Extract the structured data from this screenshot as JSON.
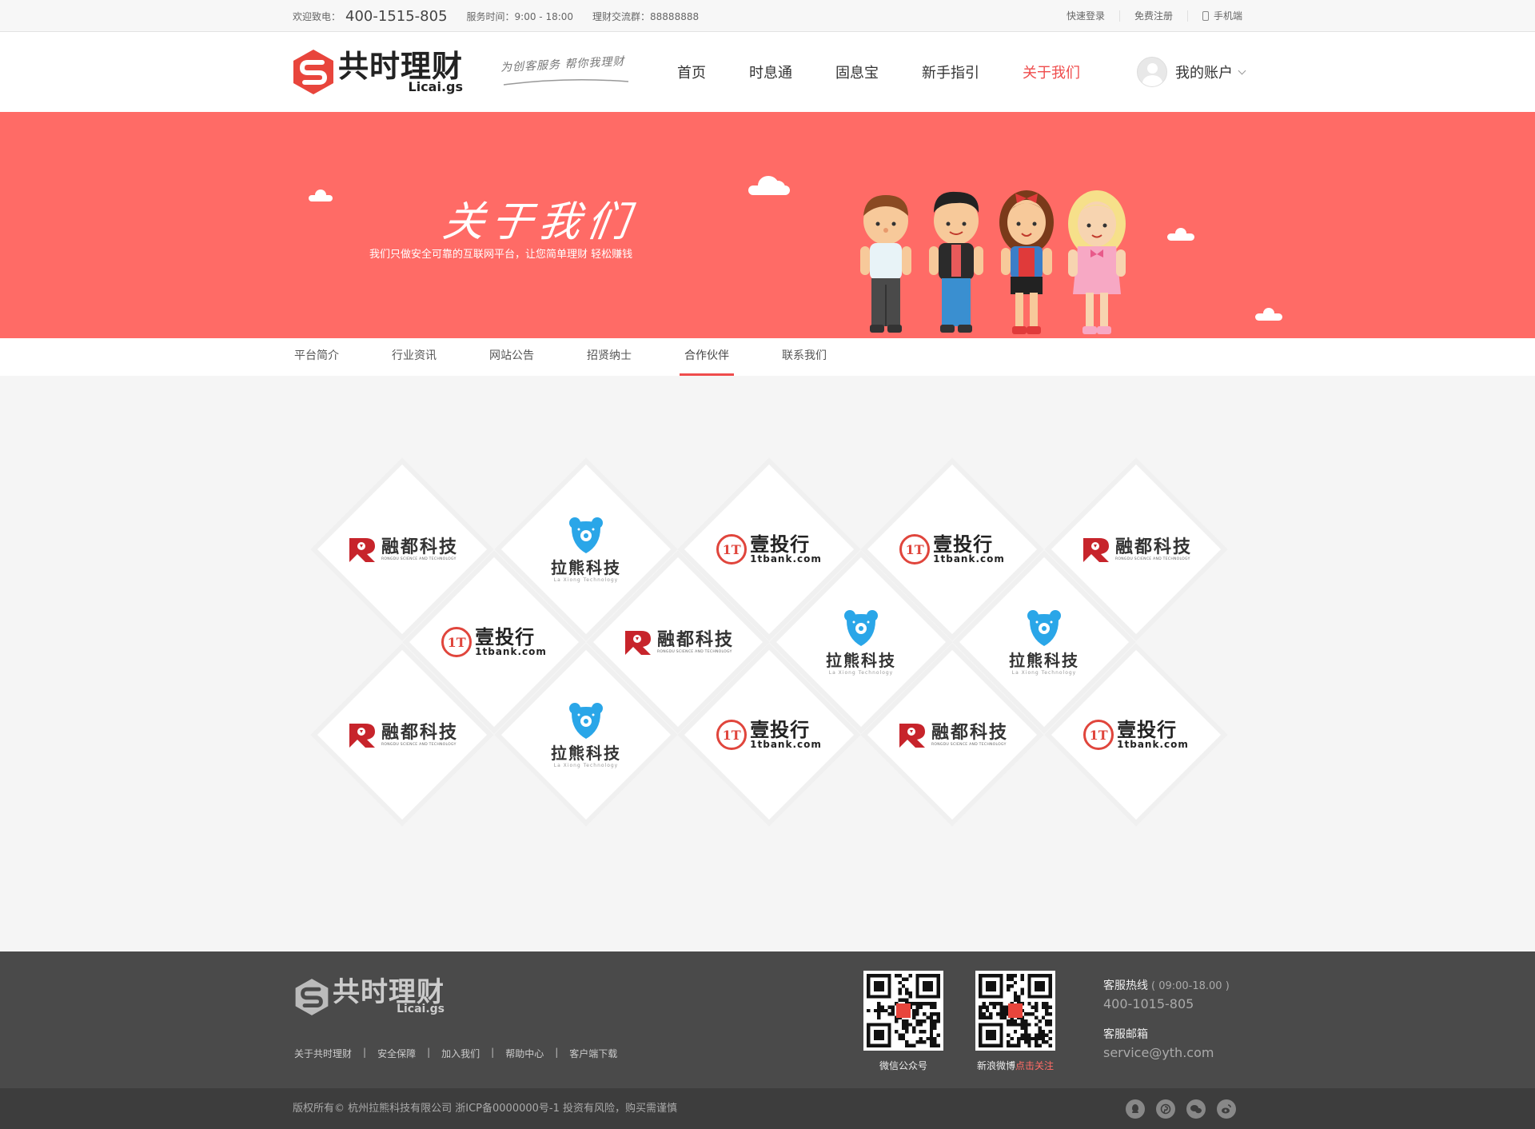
{
  "topbar": {
    "phone_label": "欢迎致电：",
    "phone": "400-1515-805",
    "service_hours": "服务时间：9:00 - 18:00",
    "group": "理财交流群：88888888",
    "quick_login": "快速登录",
    "register": "免费注册",
    "mobile": "手机端"
  },
  "header": {
    "logo_cn": "共时理财",
    "logo_en": "Licai.gs",
    "slogan": "为创客服务  帮你我理财",
    "nav": [
      "首页",
      "时息通",
      "固息宝",
      "新手指引",
      "关于我们"
    ],
    "active_nav": "关于我们",
    "account": "我的账户"
  },
  "banner": {
    "title": "关于我们",
    "subtitle": "我们只做安全可靠的互联网平台，让您简单理财  轻松赚钱"
  },
  "subnav": {
    "items": [
      "平台简介",
      "行业资讯",
      "网站公告",
      "招贤纳士",
      "合作伙伴",
      "联系我们"
    ],
    "active": "合作伙伴"
  },
  "partners": {
    "brands": {
      "rongdu": {
        "cn": "融都科技",
        "en": "RONGDU SCIENCE AND TECHNOLOGY"
      },
      "laxiong": {
        "cn": "拉熊科技",
        "en": "La Xiong Technology"
      },
      "yitouhang": {
        "cn": "壹投行",
        "en": "1tbank.com",
        "mark": "1T"
      }
    }
  },
  "footer": {
    "logo_cn": "共时理财",
    "logo_en": "Licai.gs",
    "links": [
      "关于共时理财",
      "安全保障",
      "加入我们",
      "帮助中心",
      "客户端下载"
    ],
    "separator": "|",
    "qr_wechat": "微信公众号",
    "qr_weibo": "新浪微博",
    "qr_weibo_follow": "点击关注",
    "hotline_label": "客服热线",
    "hotline_hours": "( 09:00-18.00 )",
    "hotline": "400-1015-805",
    "email_label": "客服邮箱",
    "email": "service@yth.com",
    "copyright": "版权所有©  杭州拉熊科技有限公司  浙ICP备0000000号-1  投资有风险，购买需谨慎"
  },
  "colors": {
    "accent": "#ef4c4c",
    "banner": "#ff6b66",
    "footer": "#4a4a4a",
    "bottom": "#3d3d3d"
  }
}
